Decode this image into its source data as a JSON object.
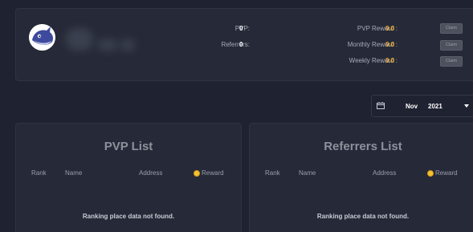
{
  "stats": {
    "pvp_label": "PVP:",
    "pvp_value": "0",
    "referrers_label": "Referrers:",
    "referrers_value": "0"
  },
  "rewards": [
    {
      "label": "PVP Reward :",
      "value": "0.0",
      "button": "Claim"
    },
    {
      "label": "Monthly Reward :",
      "value": "0.0",
      "button": "Claim"
    },
    {
      "label": "Weekly Reward :",
      "value": "0.0",
      "button": "Claim"
    }
  ],
  "date_picker": {
    "month": "Nov",
    "year": "2021"
  },
  "pvp_list": {
    "title": "PVP List",
    "columns": [
      "Rank",
      "Name",
      "Address",
      "Reward"
    ],
    "empty_message": "Ranking place data not found."
  },
  "referrers_list": {
    "title": "Referrers List",
    "columns": [
      "Rank",
      "Name",
      "Address",
      "Reward"
    ],
    "empty_message": "Ranking place data not found."
  },
  "colors": {
    "accent": "#f0a830",
    "background": "#1f2231",
    "card": "#262a38"
  }
}
